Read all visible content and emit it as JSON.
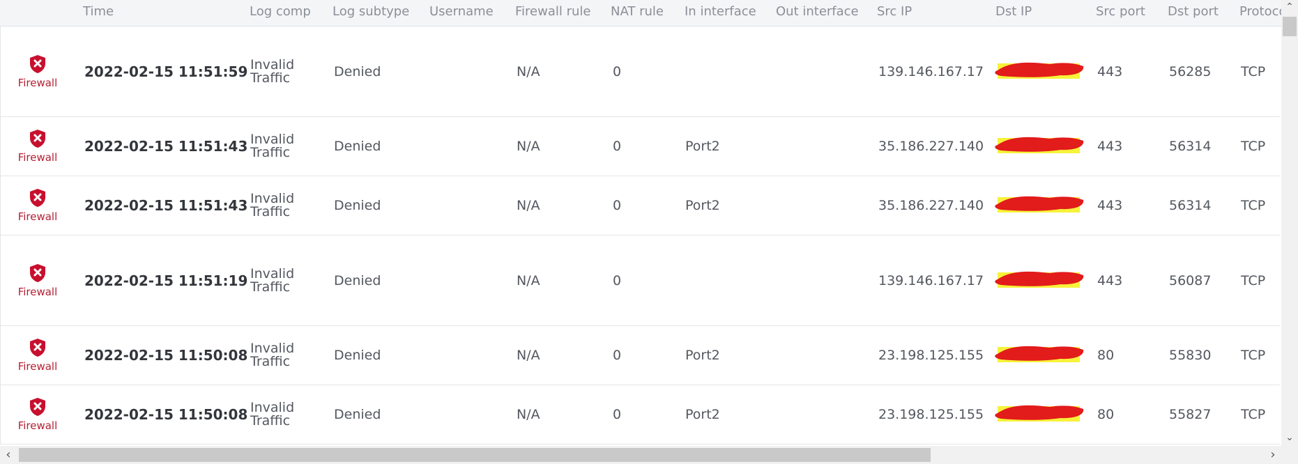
{
  "columns": {
    "time": "Time",
    "log_comp": "Log comp",
    "log_subtype": "Log subtype",
    "username": "Username",
    "firewall_rule": "Firewall rule",
    "nat_rule": "NAT rule",
    "in_interface": "In interface",
    "out_interface": "Out interface",
    "src_ip": "Src IP",
    "dst_ip": "Dst IP",
    "src_port": "Src port",
    "dst_port": "Dst port",
    "protocol": "Protoco"
  },
  "icon": {
    "name": "shield-x-icon",
    "color": "#c8102e"
  },
  "redaction": {
    "ink": "#e21b1b",
    "highlight": "#f7f23a"
  },
  "rows": [
    {
      "module": "Firewall",
      "time": "2022-02-15 11:51:59",
      "log_comp_line1": "Invalid",
      "log_comp_line2": "Traffic",
      "log_subtype": "Denied",
      "username": "",
      "firewall_rule": "N/A",
      "nat_rule": "0",
      "in_interface": "",
      "out_interface": "",
      "src_ip": "139.146.167.17",
      "src_port": "443",
      "dst_port": "56285",
      "protocol": "TCP"
    },
    {
      "module": "Firewall",
      "time": "2022-02-15 11:51:43",
      "log_comp_line1": "Invalid",
      "log_comp_line2": "Traffic",
      "log_subtype": "Denied",
      "username": "",
      "firewall_rule": "N/A",
      "nat_rule": "0",
      "in_interface": "Port2",
      "out_interface": "",
      "src_ip": "35.186.227.140",
      "src_port": "443",
      "dst_port": "56314",
      "protocol": "TCP"
    },
    {
      "module": "Firewall",
      "time": "2022-02-15 11:51:43",
      "log_comp_line1": "Invalid",
      "log_comp_line2": "Traffic",
      "log_subtype": "Denied",
      "username": "",
      "firewall_rule": "N/A",
      "nat_rule": "0",
      "in_interface": "Port2",
      "out_interface": "",
      "src_ip": "35.186.227.140",
      "src_port": "443",
      "dst_port": "56314",
      "protocol": "TCP"
    },
    {
      "module": "Firewall",
      "time": "2022-02-15 11:51:19",
      "log_comp_line1": "Invalid",
      "log_comp_line2": "Traffic",
      "log_subtype": "Denied",
      "username": "",
      "firewall_rule": "N/A",
      "nat_rule": "0",
      "in_interface": "",
      "out_interface": "",
      "src_ip": "139.146.167.17",
      "src_port": "443",
      "dst_port": "56087",
      "protocol": "TCP"
    },
    {
      "module": "Firewall",
      "time": "2022-02-15 11:50:08",
      "log_comp_line1": "Invalid",
      "log_comp_line2": "Traffic",
      "log_subtype": "Denied",
      "username": "",
      "firewall_rule": "N/A",
      "nat_rule": "0",
      "in_interface": "Port2",
      "out_interface": "",
      "src_ip": "23.198.125.155",
      "src_port": "80",
      "dst_port": "55830",
      "protocol": "TCP"
    },
    {
      "module": "Firewall",
      "time": "2022-02-15 11:50:08",
      "log_comp_line1": "Invalid",
      "log_comp_line2": "Traffic",
      "log_subtype": "Denied",
      "username": "",
      "firewall_rule": "N/A",
      "nat_rule": "0",
      "in_interface": "Port2",
      "out_interface": "",
      "src_ip": "23.198.125.155",
      "src_port": "80",
      "dst_port": "55827",
      "protocol": "TCP"
    }
  ]
}
